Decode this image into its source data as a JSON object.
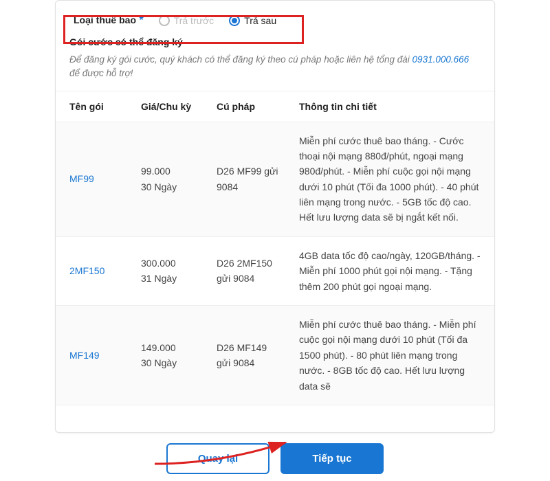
{
  "subscriber": {
    "label": "Loại thuê bao",
    "options": {
      "prepaid": "Trả trước",
      "postpaid": "Trả sau"
    }
  },
  "section": {
    "title": "Gói cước có thể đăng ký",
    "note_prefix": "Để đăng ký gói cước, quý khách có thể đăng ký theo cú pháp hoặc liên hệ tổng đài ",
    "note_phone": "0931.000.666",
    "note_suffix": " để được hỗ trợ!"
  },
  "table": {
    "headers": {
      "name": "Tên gói",
      "price": "Giá/Chu kỳ",
      "syntax": "Cú pháp",
      "detail": "Thông tin chi tiết"
    },
    "rows": [
      {
        "name": "MF99",
        "price": "99.000",
        "cycle": "30 Ngày",
        "syntax": "D26 MF99 gửi 9084",
        "detail": "Miễn phí cước thuê bao tháng. - Cước thoại nội mạng 880đ/phút, ngoại mạng 980đ/phút. - Miễn phí cuộc gọi nội mạng dưới 10 phút (Tối đa 1000 phút). - 40 phút liên mạng trong nước. - 5GB tốc độ cao. Hết lưu lượng data sẽ bị ngắt kết nối."
      },
      {
        "name": "2MF150",
        "price": "300.000",
        "cycle": "31 Ngày",
        "syntax": "D26 2MF150 gửi 9084",
        "detail": "4GB data tốc độ cao/ngày, 120GB/tháng. - Miễn phí 1000 phút gọi nội mạng. - Tặng thêm 200 phút gọi ngoại mạng."
      },
      {
        "name": "MF149",
        "price": "149.000",
        "cycle": "30 Ngày",
        "syntax": "D26 MF149 gửi 9084",
        "detail": "Miễn phí cước thuê bao tháng. - Miễn phí cuộc gọi nội mạng dưới 10 phút (Tối đa 1500 phút). - 80 phút liên mạng trong nước. - 8GB tốc độ cao. Hết lưu lượng data sẽ"
      }
    ]
  },
  "footer": {
    "back": "Quay lại",
    "next": "Tiếp tục"
  },
  "colors": {
    "primary": "#1976d2",
    "highlight": "#d22"
  }
}
